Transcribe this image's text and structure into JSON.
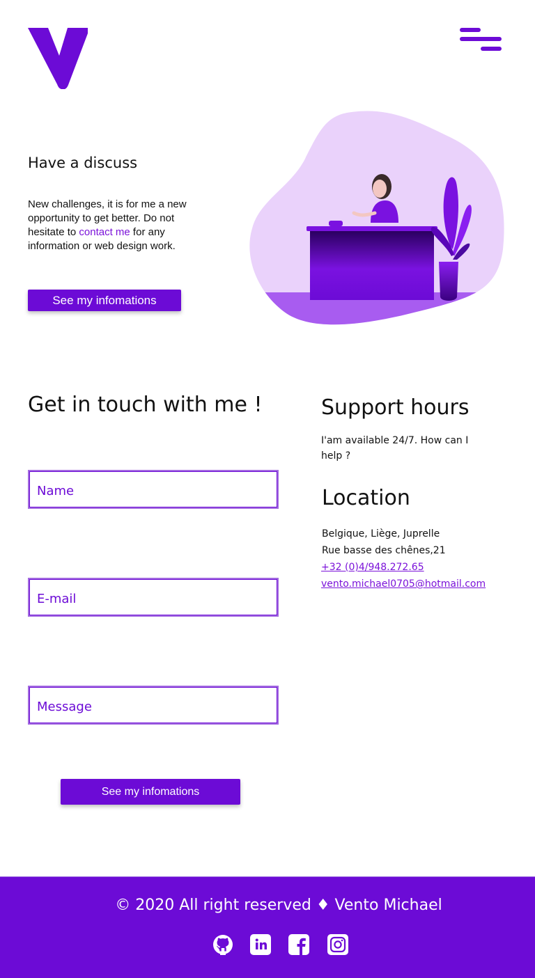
{
  "header": {
    "logo_icon": "v-logo-icon",
    "menu_icon": "hamburger-menu-icon"
  },
  "hero": {
    "title": "Have a discuss",
    "text_before_link": "New challenges, it is for me a new opportunity to get better. Do not hesitate to ",
    "link_text": "contact me",
    "text_after_link": " for any information or web design work.",
    "button_label": "See my infomations",
    "illustration_icon": "person-at-desk-illustration"
  },
  "contact": {
    "title": "Get in touch with me !",
    "name_placeholder": "Name",
    "email_placeholder": "E-mail",
    "message_placeholder": "Message",
    "button_label": "See my infomations"
  },
  "support": {
    "title": "Support hours",
    "text": "I'am available 24/7. How can I help ?"
  },
  "location": {
    "title": "Location",
    "address_line1": "Belgique, Liège, Juprelle",
    "address_line2": "Rue basse des chênes,21",
    "phone": "+32 (0)4/948.272.65",
    "email": "vento.michael0705@hotmail.com"
  },
  "footer": {
    "text": "© 2020 All right reserved ♦ Vento Michael",
    "social": [
      "github-icon",
      "linkedin-icon",
      "facebook-icon",
      "instagram-icon"
    ]
  },
  "colors": {
    "accent": "#6c0bd6",
    "accent_light": "#ead2fb",
    "link": "#7b12d9",
    "footer_bg": "#6c0bd6"
  }
}
